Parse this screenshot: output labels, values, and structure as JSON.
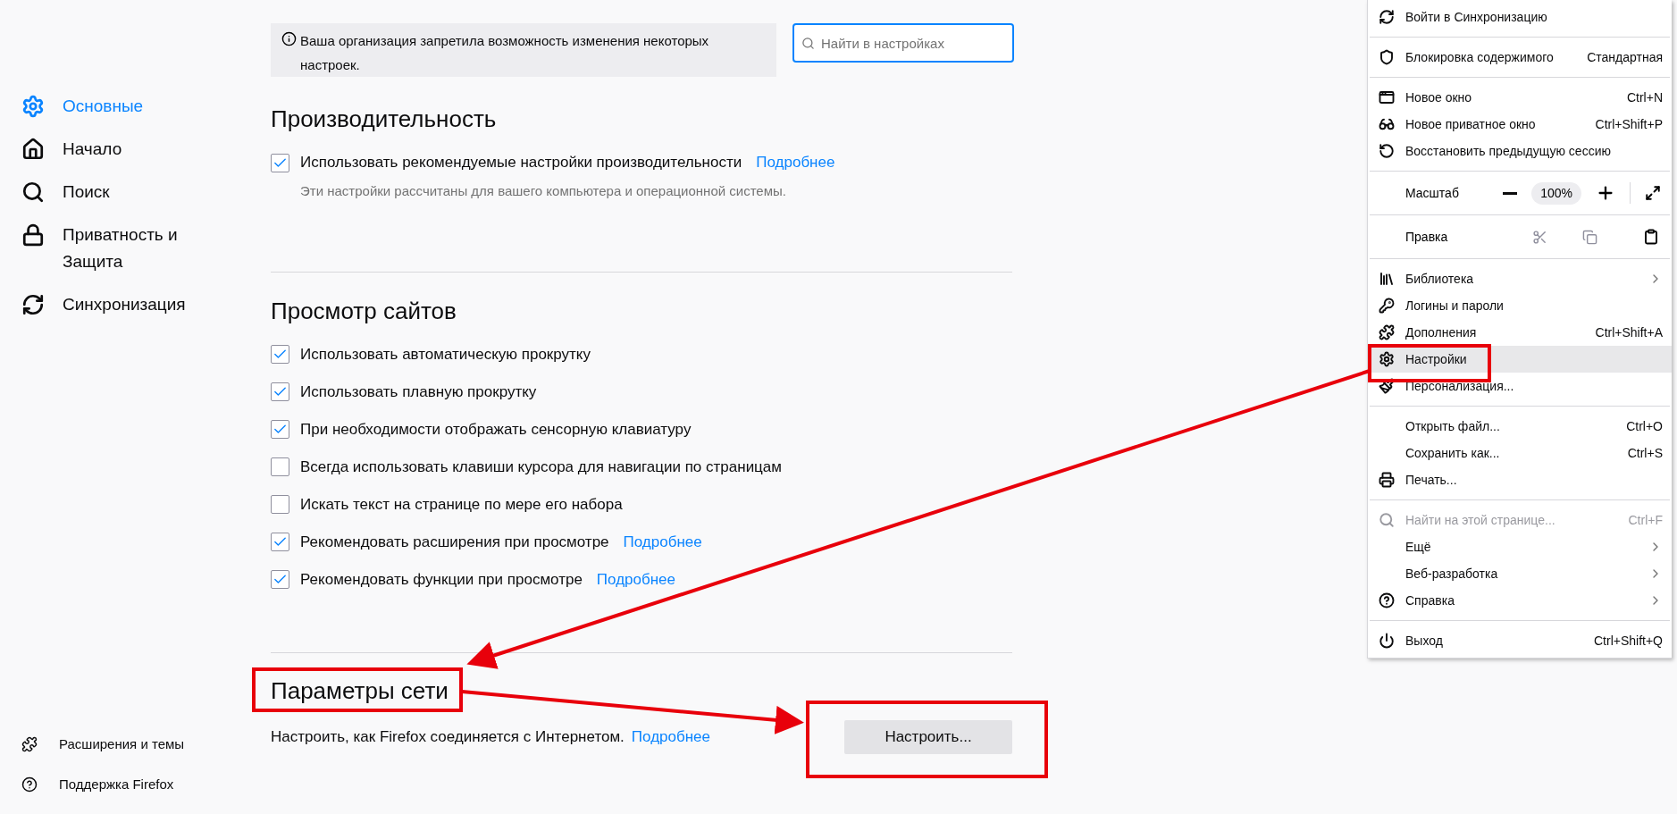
{
  "sidebar": {
    "items": [
      {
        "label": "Основные",
        "selected": true
      },
      {
        "label": "Начало",
        "selected": false
      },
      {
        "label": "Поиск",
        "selected": false
      },
      {
        "label": "Приватность и Защита",
        "selected": false
      },
      {
        "label": "Синхронизация",
        "selected": false
      }
    ],
    "footer_items": [
      {
        "label": "Расширения и темы"
      },
      {
        "label": "Поддержка Firefox"
      }
    ]
  },
  "notice": {
    "text": "Ваша организация запретила возможность изменения некоторых настроек."
  },
  "search": {
    "placeholder": "Найти в настройках"
  },
  "sections": [
    {
      "title": "Производительность",
      "settings": [
        {
          "label": "Использовать рекомендуемые настройки производительности",
          "checked": true,
          "link": "Подробнее",
          "hint": "Эти настройки рассчитаны для вашего компьютера и операционной системы."
        }
      ]
    },
    {
      "title": "Просмотр сайтов",
      "settings": [
        {
          "label": "Использовать автоматическую прокрутку",
          "checked": true
        },
        {
          "label": "Использовать плавную прокрутку",
          "checked": true
        },
        {
          "label": "При необходимости отображать сенсорную клавиатуру",
          "checked": true
        },
        {
          "label": "Всегда использовать клавиши курсора для навигации по страницам",
          "checked": false
        },
        {
          "label": "Искать текст на странице по мере его набора",
          "checked": false
        },
        {
          "label": "Рекомендовать расширения при просмотре",
          "checked": true,
          "link": "Подробнее"
        },
        {
          "label": "Рекомендовать функции при просмотре",
          "checked": true,
          "link": "Подробнее"
        }
      ]
    }
  ],
  "network": {
    "title": "Параметры сети",
    "description": "Настроить, как Firefox соединяется с Интернетом.",
    "link": "Подробнее",
    "button": "Настроить..."
  },
  "menu": [
    {
      "kind": "item",
      "label": "Войти в Синхронизацию",
      "selected": false,
      "disabled": false,
      "submenu": false
    },
    {
      "kind": "divider"
    },
    {
      "kind": "item",
      "label": "Блокировка содержимого",
      "detail": "Стандартная",
      "selected": false,
      "disabled": false,
      "submenu": false
    },
    {
      "kind": "divider"
    },
    {
      "kind": "item",
      "label": "Новое окно",
      "shortcut": "Ctrl+N",
      "selected": false,
      "disabled": false,
      "submenu": false
    },
    {
      "kind": "item",
      "label": "Новое приватное окно",
      "shortcut": "Ctrl+Shift+P",
      "selected": false,
      "disabled": false,
      "submenu": false
    },
    {
      "kind": "item",
      "label": "Восстановить предыдущую сессию",
      "selected": false,
      "disabled": false,
      "submenu": false
    },
    {
      "kind": "divider"
    },
    {
      "kind": "zoom",
      "label": "Масштаб",
      "value": "100%"
    },
    {
      "kind": "divider"
    },
    {
      "kind": "edit",
      "label": "Правка"
    },
    {
      "kind": "divider"
    },
    {
      "kind": "item",
      "label": "Библиотека",
      "selected": false,
      "disabled": false,
      "submenu": true
    },
    {
      "kind": "item",
      "label": "Логины и пароли",
      "selected": false,
      "disabled": false,
      "submenu": false
    },
    {
      "kind": "item",
      "label": "Дополнения",
      "shortcut": "Ctrl+Shift+A",
      "selected": false,
      "disabled": false,
      "submenu": false
    },
    {
      "kind": "item",
      "label": "Настройки",
      "selected": true,
      "disabled": false,
      "submenu": false
    },
    {
      "kind": "item",
      "label": "Персонализация...",
      "selected": false,
      "disabled": false,
      "submenu": false
    },
    {
      "kind": "divider"
    },
    {
      "kind": "item",
      "label": "Открыть файл...",
      "shortcut": "Ctrl+O",
      "selected": false,
      "disabled": false,
      "submenu": false
    },
    {
      "kind": "item",
      "label": "Сохранить как...",
      "shortcut": "Ctrl+S",
      "selected": false,
      "disabled": false,
      "submenu": false
    },
    {
      "kind": "item",
      "label": "Печать...",
      "selected": false,
      "disabled": false,
      "submenu": false
    },
    {
      "kind": "divider"
    },
    {
      "kind": "item",
      "label": "Найти на этой странице...",
      "shortcut": "Ctrl+F",
      "selected": false,
      "disabled": true,
      "submenu": false
    },
    {
      "kind": "item",
      "label": "Ещё",
      "selected": false,
      "disabled": false,
      "submenu": true
    },
    {
      "kind": "item",
      "label": "Веб-разработка",
      "selected": false,
      "disabled": false,
      "submenu": true
    },
    {
      "kind": "item",
      "label": "Справка",
      "selected": false,
      "disabled": false,
      "submenu": true
    },
    {
      "kind": "divider"
    },
    {
      "kind": "item",
      "label": "Выход",
      "shortcut": "Ctrl+Shift+Q",
      "selected": false,
      "disabled": false,
      "submenu": false
    }
  ]
}
